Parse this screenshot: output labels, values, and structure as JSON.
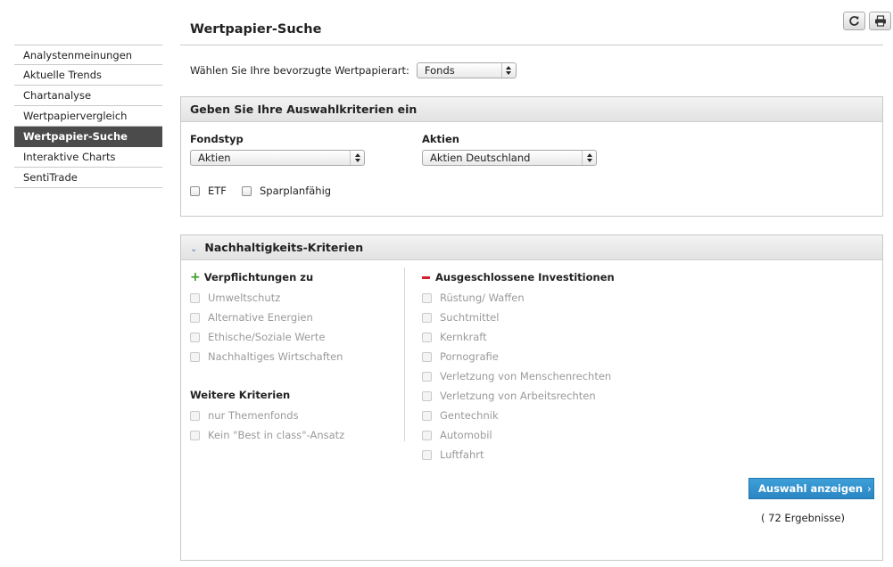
{
  "sidebar": {
    "items": [
      {
        "label": "Analystenmeinungen"
      },
      {
        "label": "Aktuelle Trends"
      },
      {
        "label": "Chartanalyse"
      },
      {
        "label": "Wertpapiervergleich"
      },
      {
        "label": "Wertpapier-Suche",
        "active": true
      },
      {
        "label": "Interaktive Charts"
      },
      {
        "label": "SentiTrade"
      }
    ]
  },
  "toolbar": {
    "refresh_icon": "refresh-icon",
    "print_icon": "print-icon"
  },
  "page": {
    "title": "Wertpapier-Suche",
    "type_label": "Wählen Sie Ihre bevorzugte Wertpapierart:",
    "type_value": "Fonds"
  },
  "criteria": {
    "header": "Geben Sie Ihre Auswahlkriterien ein",
    "fondstyp_label": "Fondstyp",
    "fondstyp_value": "Aktien",
    "aktien_label": "Aktien",
    "aktien_value": "Aktien Deutschland",
    "etf_label": "ETF",
    "sparplan_label": "Sparplanfähig"
  },
  "sustainability": {
    "header": "Nachhaltigkeits-Kriterien",
    "commitments_title": "Verpflichtungen zu",
    "commitments": [
      "Umweltschutz",
      "Alternative Energien",
      "Ethische/Soziale Werte",
      "Nachhaltiges Wirtschaften"
    ],
    "further_title": "Weitere Kriterien",
    "further": [
      "nur Themenfonds",
      "Kein \"Best in class\"-Ansatz"
    ],
    "excluded_title": "Ausgeschlossene Investitionen",
    "excluded": [
      "Rüstung/ Waffen",
      "Suchtmittel",
      "Kernkraft",
      "Pornografie",
      "Verletzung von Menschenrechten",
      "Verletzung von Arbeitsrechten",
      "Gentechnik",
      "Automobil",
      "Luftfahrt"
    ],
    "submit_label": "Auswahl anzeigen",
    "results_text": "( 72 Ergebnisse)"
  },
  "colors": {
    "accent": "#2a86c4",
    "sidebar_active": "#4b4b4b",
    "plus": "#3a9a2a",
    "minus": "#d0202a"
  }
}
